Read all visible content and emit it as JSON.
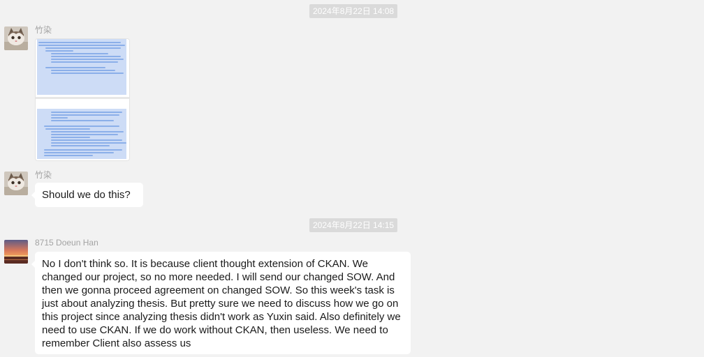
{
  "messages": [
    {
      "type": "timestamp",
      "text": "2024年8月22日 14:08"
    },
    {
      "type": "image",
      "sender": "竹染"
    },
    {
      "type": "text",
      "sender": "竹染",
      "text": "Should we do this?"
    },
    {
      "type": "timestamp",
      "text": "2024年8月22日 14:15"
    },
    {
      "type": "text",
      "sender": "8715 Doeun Han",
      "lines": [
        "No I don't think so. It is because client thought extension of CKAN. We",
        "changed our project, so no more needed. I will send our changed SOW. And",
        "then we gonna proceed agreement on changed SOW. So this week's task is",
        "just about analyzing thesis. But pretty sure we need to discuss how we go on",
        "this project since analyzing thesis didn't work as Yuxin said. Also definitely we",
        "need to use CKAN. If we do work without CKAN, then useless. We need to",
        "remember Client also assess us"
      ]
    }
  ],
  "colors": {
    "background": "#f2f2f2",
    "bubble": "#ffffff",
    "timestamp_bg": "#dadada",
    "selection": "#cddcf6"
  },
  "icons": {
    "cat_avatar": "cat-avatar-icon",
    "sunset_avatar": "sunset-avatar-icon"
  }
}
